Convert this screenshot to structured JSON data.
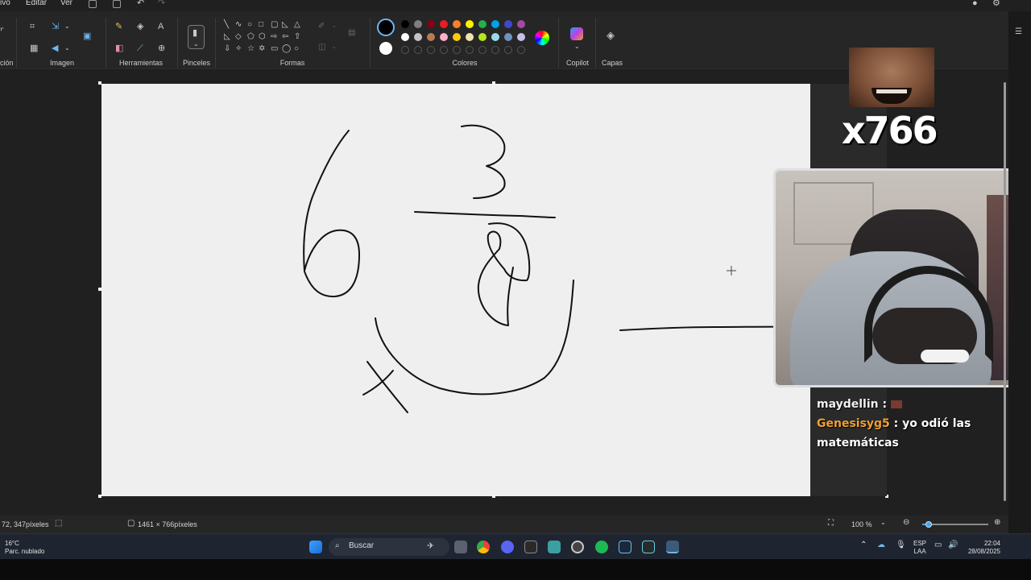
{
  "menu": {
    "items": [
      "ivo",
      "Editar",
      "Ver"
    ]
  },
  "ribbon": {
    "groups": {
      "seleccion": "ción",
      "imagen": "Imagen",
      "herramientas": "Herramientas",
      "pinceles": "Pinceles",
      "formas": "Formas",
      "colores": "Colores",
      "copilot": "Copilot",
      "capas": "Capas"
    },
    "tools": {
      "text_tool": "A"
    },
    "palette_row1": [
      "#000000",
      "#7f7f7f",
      "#880015",
      "#ed1c24",
      "#ff7f27",
      "#fff200",
      "#22b14c",
      "#00a2e8",
      "#3f48cc",
      "#a349a4"
    ],
    "palette_row2": [
      "#ffffff",
      "#c3c3c3",
      "#b97a57",
      "#ffaec9",
      "#ffc90e",
      "#efe4b0",
      "#b5e61d",
      "#99d9ea",
      "#7092be",
      "#c8bfe7"
    ],
    "primary_color": "#000000",
    "secondary_color": "#ffffff"
  },
  "stream_overlay": {
    "counter": "x766",
    "chat": [
      {
        "user": "maydellin",
        "sep": " :",
        "message": ""
      },
      {
        "user": "Genesisyg5",
        "sep": " :",
        "message": " yo odió las matemáticas"
      }
    ]
  },
  "statusbar": {
    "cursor_pos": "72, 347píxeles",
    "canvas_size": "1461 × 766píxeles",
    "zoom": "100 %",
    "zoom_level_fraction": 0.1
  },
  "taskbar": {
    "weather_temp": "16°C",
    "weather_desc": "Parc. nublado",
    "search_label": "Buscar",
    "lang_line1": "ESP",
    "lang_line2": "LAA",
    "time": "22:04",
    "date": "28/08/2025"
  }
}
